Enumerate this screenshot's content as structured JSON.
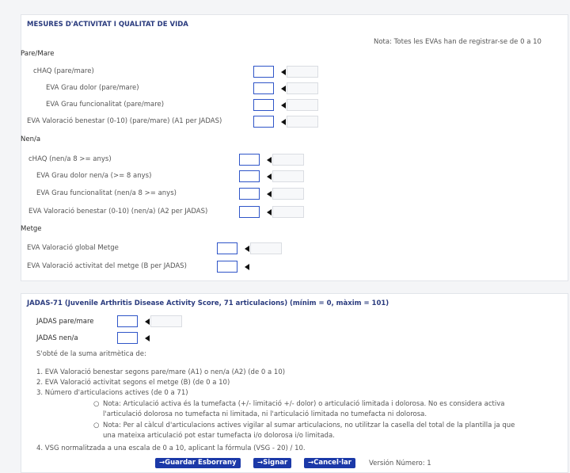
{
  "section_title": "MESURES D'ACTIVITAT I QUALITAT DE VIDA",
  "note": "Nota: Totes les EVAs han de registrar-se de 0 a 10",
  "parent": {
    "heading": "Pare/Mare",
    "chaq": "cHAQ (pare/mare)",
    "pain": "EVA Grau dolor (pare/mare)",
    "function": "EVA Grau funcionalitat (pare/mare)",
    "wellbeing": "EVA Valoració benestar (0-10) (pare/mare) (A1 per JADAS)"
  },
  "child": {
    "heading": "Nen/a",
    "chaq": "cHAQ (nen/a 8 >= anys)",
    "pain": "EVA Grau dolor nen/a (>= 8 anys)",
    "function": "EVA Grau funcionalitat (nen/a 8 >= anys)",
    "wellbeing": "EVA Valoració benestar (0-10) (nen/a) (A2 per JADAS)"
  },
  "doctor": {
    "heading": "Metge",
    "global": "EVA Valoració global Metge",
    "activity": "EVA Valoració activitat del metge (B per JADAS)"
  },
  "jadas": {
    "title": "JADAS-71 (Juvenile Arthritis Disease Activity Score, 71 articulacions) (mínim = 0, màxim = 101)",
    "parent_label": "JADAS pare/mare",
    "child_label": "JADAS nen/a",
    "sum_intro": "S'obté de la suma aritmètica de:",
    "items": [
      "1.   EVA Valoració benestar segons pare/mare (A1) o nen/a (A2) (de 0 a 10)",
      "2.   EVA Valoració activitat segons el metge (B) (de 0 a 10)",
      "3.   Número d'articulacions actives (de 0 a 71)"
    ],
    "note1_a": "Nota: Articulació activa és la tumefacta (+/- limitació +/- dolor) o articulació limitada i dolorosa. No es considera activa",
    "note1_b": "l'articulació dolorosa no tumefacta ni limitada, ni l'articulació limitada no tumefacta ni dolorosa.",
    "note2_a": "Nota: Per al càlcul d'articulacions actives vigilar al sumar articulacions, no utilitzar la casella del total de la plantilla ja que",
    "note2_b": "una mateixa articulació pot estar tumefacta i/o dolorosa i/o limitada.",
    "item4": "4.   VSG normalitzada a una escala de 0 a 10, aplicant la fórmula (VSG - 20) / 10."
  },
  "footer": {
    "save_draft": "→Guardar Esborrany",
    "sign": "→Signar",
    "cancel": "→Cancel·lar",
    "version": "Versión Número: 1"
  },
  "colors": {
    "header": "#2a3b7e",
    "button": "#1b39a8",
    "input_border": "#2f55c8"
  }
}
